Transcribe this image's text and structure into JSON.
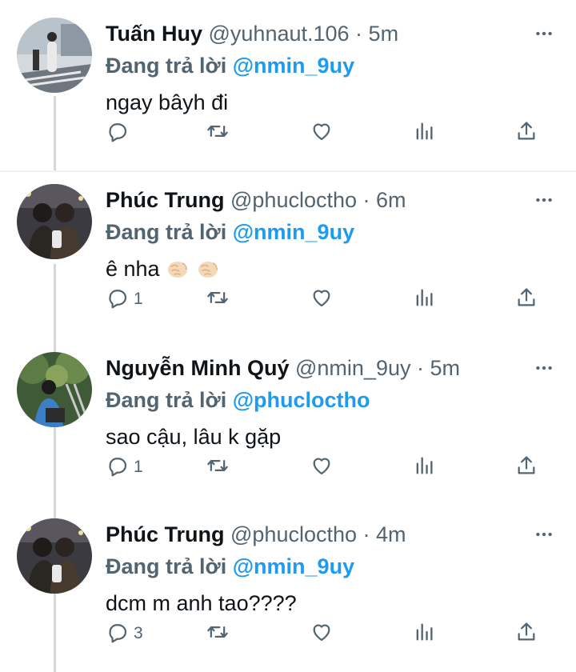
{
  "colors": {
    "accent": "#1d9bf0",
    "secondary_text": "#536471",
    "thread_line": "#cfd9de"
  },
  "tweets": [
    {
      "name": "Tuấn Huy",
      "handle": "@yuhnaut.106",
      "dot": "·",
      "time": "5m",
      "reply_prefix": "Đang trả lời",
      "reply_to": "@nmin_9uy",
      "text": "ngay bâyh đi",
      "emojis": [],
      "reply_count": "",
      "avatar_icon": "avatar-street-photo"
    },
    {
      "name": "Phúc Trung",
      "handle": "@phucloctho",
      "dot": "·",
      "time": "6m",
      "reply_prefix": "Đang trả lời",
      "reply_to": "@nmin_9uy",
      "text": "ê nha",
      "emojis": [
        "fist-bump-emoji",
        "fist-bump-emoji"
      ],
      "reply_count": "1",
      "avatar_icon": "avatar-two-people-night"
    },
    {
      "name": "Nguyễn Minh Quý",
      "handle": "@nmin_9uy",
      "dot": "·",
      "time": "5m",
      "reply_prefix": "Đang trả lời",
      "reply_to": "@phucloctho",
      "text": "sao cậu, lâu k gặp",
      "emojis": [],
      "reply_count": "1",
      "avatar_icon": "avatar-person-tree"
    },
    {
      "name": "Phúc Trung",
      "handle": "@phucloctho",
      "dot": "·",
      "time": "4m",
      "reply_prefix": "Đang trả lời",
      "reply_to": "@nmin_9uy",
      "text": "dcm m anh tao????",
      "emojis": [],
      "reply_count": "3",
      "avatar_icon": "avatar-two-people-night"
    }
  ],
  "action_icons": [
    "reply-icon",
    "retweet-icon",
    "like-icon",
    "views-icon",
    "share-icon"
  ]
}
